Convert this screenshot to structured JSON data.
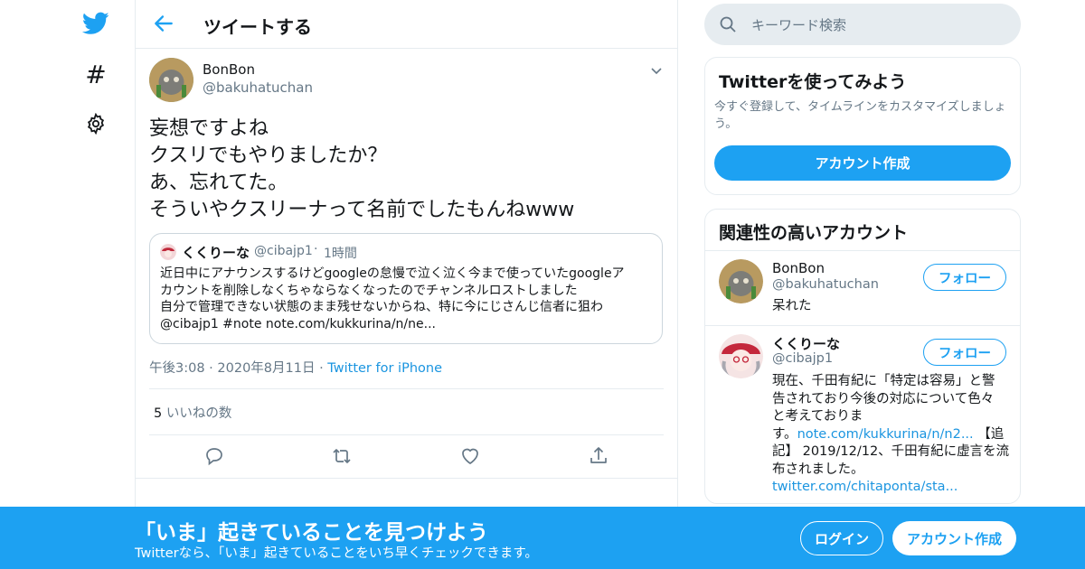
{
  "nav": {
    "items": [
      {
        "icon": "twitter-bird-icon"
      },
      {
        "icon": "hashtag-icon",
        "glyph": "#"
      },
      {
        "icon": "gear-icon"
      }
    ]
  },
  "header": {
    "title": "ツイートする"
  },
  "tweet": {
    "author_name": "BonBon",
    "author_handle": "@bakuhatuchan",
    "lines": [
      "妄想ですよね",
      "クスリでもやりましたか？",
      "あ、忘れてた。",
      "そういやクスリーナって名前でしたもんねwww"
    ],
    "quote": {
      "name": "くくりーな",
      "handle": "@cibajp1",
      "separator": "·",
      "time": "1時間",
      "lines": [
        "近日中にアナウンスするけどgoogleの怠慢で泣く泣く今まで使っていたgoogleア",
        "カウントを削除しなくちゃならなくなったのでチャンネルロストしました",
        "自分で管理できない状態のまま残せないからね、特に今にじさんじ信者に狙わ",
        "@cibajp1 #note note.com/kukkurina/n/ne..."
      ]
    },
    "time": "午後3:08",
    "separator": "·",
    "date": "2020年8月11日",
    "source": "Twitter for iPhone",
    "like_count": "5",
    "like_label": "いいねの数"
  },
  "search": {
    "placeholder": "キーワード検索"
  },
  "signup_card": {
    "title": "Twitterを使ってみよう",
    "desc_line1": "今すぐ登録して、タイムラインをカスタマイズしましょ",
    "desc_line2": "う。",
    "button": "アカウント作成"
  },
  "related": {
    "title": "関連性の高いアカウント",
    "follow_label": "フォロー",
    "accounts": [
      {
        "name": "BonBon",
        "handle": "@bakuhatuchan",
        "bio": "呆れた"
      },
      {
        "name": "くくりーな",
        "handle": "@cibajp1",
        "bio_line1": "現在、千田有紀に「特定は容易」と警",
        "bio_line2": "告されており今後の対応について色々",
        "bio_line3": "と考えておりま",
        "bio_line4_prefix": "す。",
        "bio_link1": "note.com/kukkurina/n/n2...",
        "bio_line4_suffix": " 【追",
        "bio_line5": "記】 2019/12/12、千田有紀に虚言を流",
        "bio_line6": "布されました。",
        "bio_link2": "twitter.com/chitaponta/sta..."
      }
    ]
  },
  "bottom_bar": {
    "title": "「いま」起きていることを見つけよう",
    "subtitle": "Twitterなら、「いま」起きていることをいち早くチェックできます。",
    "login": "ログイン",
    "signup": "アカウント作成"
  },
  "colors": {
    "brand": "#1da1f2",
    "link": "#1b95e0",
    "secondary_text": "#657786",
    "border": "#e6ecf0"
  }
}
